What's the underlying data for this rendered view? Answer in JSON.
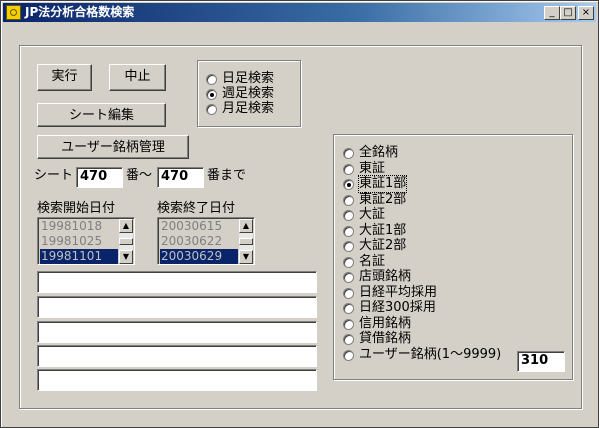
{
  "window": {
    "title": "JP法分析合格数検索",
    "minimize": "_",
    "maximize": "□",
    "close": "×"
  },
  "actions": {
    "run_label": "実行",
    "stop_label": "中止",
    "sheet_edit_label": "シート編集",
    "user_stock_label": "ユーザー銘柄管理"
  },
  "period": {
    "options": [
      "日足検索",
      "週足検索",
      "月足検索"
    ],
    "selected": "週足検索"
  },
  "sheet": {
    "prefix": "シート",
    "from": "470",
    "between": "番〜",
    "to": "470",
    "suffix": "番まで"
  },
  "dates": {
    "start_label": "検索開始日付",
    "start_items": [
      "19981018",
      "19981025",
      "19981101"
    ],
    "start_selected": "19981101",
    "end_label": "検索終了日付",
    "end_items": [
      "20030615",
      "20030622",
      "20030629"
    ],
    "end_selected": "20030629"
  },
  "text_fields": [
    "",
    "",
    "",
    "",
    ""
  ],
  "market": {
    "options": [
      "全銘柄",
      "東証",
      "東証1部",
      "東証2部",
      "大証",
      "大証1部",
      "大証2部",
      "名証",
      "店頭銘柄",
      "日経平均採用",
      "日経300採用",
      "信用銘柄",
      "貸借銘柄",
      "ユーザー銘柄(1〜9999)"
    ],
    "selected": "東証1部",
    "user_stock_value": "310"
  },
  "icons": {
    "app": "app-icon",
    "scroll_up": "scroll-up-arrow-icon",
    "scroll_down": "scroll-down-arrow-icon"
  }
}
